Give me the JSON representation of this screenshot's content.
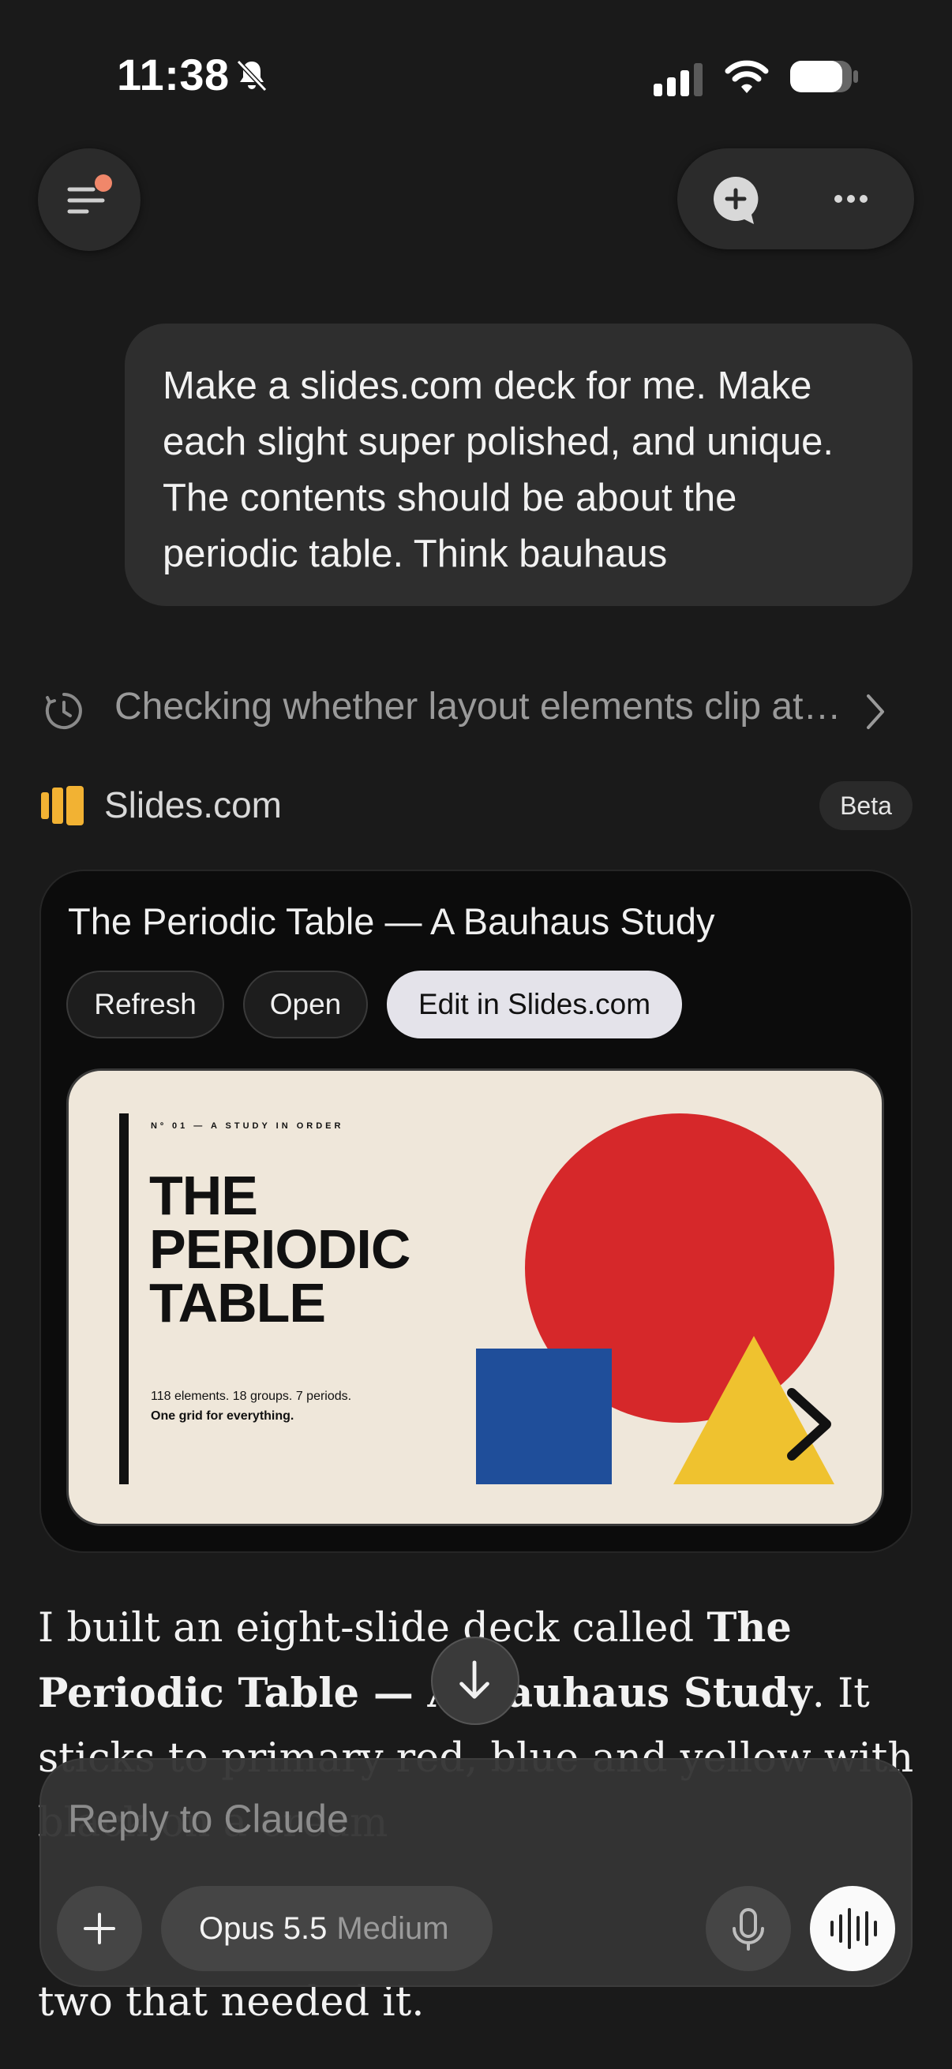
{
  "status_bar": {
    "time": "11:38"
  },
  "user_message": "Make a slides.com deck for me. Make each slight super polished, and unique. The contents should be about the periodic table. Think bauhaus",
  "thinking": {
    "text": "Checking whether layout elements clip at…"
  },
  "integration": {
    "name": "Slides.com",
    "badge": "Beta"
  },
  "card": {
    "title": "The Periodic Table — A Bauhaus Study",
    "buttons": {
      "refresh": "Refresh",
      "open": "Open",
      "edit": "Edit in Slides.com"
    },
    "slide": {
      "kicker": "Nº 01 — A STUDY IN ORDER",
      "title_lines": [
        "THE",
        "PERIODIC",
        "TABLE"
      ],
      "line1": "118 elements. 18 groups. 7 periods.",
      "line2": "One grid for everything."
    }
  },
  "answer": {
    "p1_pre": "I built an eight-slide deck called ",
    "p1_bold": "The Periodic Table — A Bauhaus Study",
    "p1_post": ". It sticks to primary red, blue and yellow with black on a cream",
    "tail": "two that needed it."
  },
  "composer": {
    "placeholder": "Reply to Claude",
    "model": "Opus 5.5",
    "effort": "Medium"
  },
  "colors": {
    "background": "#1a1a1a",
    "bauhaus_red": "#d6282a",
    "bauhaus_blue": "#1f4e9a",
    "bauhaus_yellow": "#efc22f",
    "slide_cream": "#efe7da",
    "notification_dot": "#f0876a",
    "slides_logo": "#f2b233"
  },
  "icons": [
    "bell-off-icon",
    "signal-icon",
    "wifi-icon",
    "battery-icon",
    "menu-icon",
    "new-chat-icon",
    "more-icon",
    "clock-icon",
    "chevron-right-icon",
    "slides-logo-icon",
    "arrow-down-icon",
    "plus-icon",
    "mic-icon",
    "voice-wave-icon"
  ]
}
